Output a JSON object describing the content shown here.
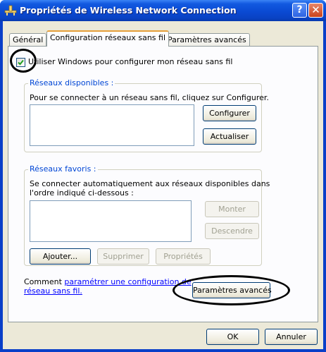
{
  "window": {
    "title": "Propriétés de Wireless Network Connection",
    "help_label": "?",
    "close_label": "✕"
  },
  "tabs": [
    {
      "label": "Général",
      "active": false
    },
    {
      "label": "Configuration réseaux sans fil",
      "active": true
    },
    {
      "label": "Paramètres avancés",
      "active": false
    }
  ],
  "use_windows": {
    "label": "Utiliser Windows pour configurer mon réseau sans fil",
    "checked": true
  },
  "available_networks": {
    "group_label": "Réseaux disponibles :",
    "description": "Pour se connecter à un réseau sans fil, cliquez sur Configurer.",
    "configure_label": "Configurer",
    "refresh_label": "Actualiser"
  },
  "preferred_networks": {
    "group_label": "Réseaux favoris :",
    "description_line1": "Se connecter automatiquement aux réseaux disponibles dans",
    "description_line2": "l'ordre indiqué ci-dessous :",
    "move_up_label": "Monter",
    "move_down_label": "Descendre",
    "add_label": "Ajouter...",
    "remove_label": "Supprimer",
    "properties_label": "Propriétés"
  },
  "advanced": {
    "text_prefix": "Comment ",
    "link_line1": "paramétrer une configuration de",
    "link_line2": "réseau sans fil.",
    "button_label": "Paramètres avancés"
  },
  "footer": {
    "ok_label": "OK",
    "cancel_label": "Annuler"
  },
  "colors": {
    "titlebar": "#0a4ad3",
    "dialog_bg": "#ece9d8",
    "group_label": "#0046d5",
    "link": "#0000ff"
  }
}
